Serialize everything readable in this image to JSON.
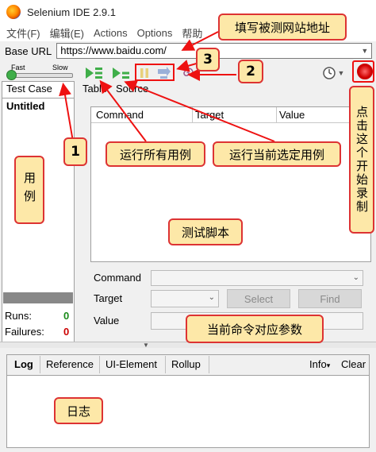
{
  "window": {
    "title": "Selenium IDE 2.9.1"
  },
  "menu": [
    "文件(F)",
    "编辑(E)",
    "Actions",
    "Options",
    "帮助"
  ],
  "base_url": {
    "label": "Base URL",
    "value": "https://www.baidu.com/"
  },
  "speed": {
    "fast_label": "Fast",
    "slow_label": "Slow"
  },
  "test_case_panel": {
    "header": "Test Case",
    "item": "Untitled",
    "runs_label": "Runs:",
    "runs_value": "0",
    "failures_label": "Failures:",
    "failures_value": "0"
  },
  "editor_tabs": {
    "table": "Table",
    "source": "Source"
  },
  "grid": {
    "columns": [
      "Command",
      "Target",
      "Value"
    ]
  },
  "form": {
    "command_label": "Command",
    "target_label": "Target",
    "value_label": "Value",
    "select_button": "Select",
    "find_button": "Find"
  },
  "log_tabs": {
    "log": "Log",
    "reference": "Reference",
    "ui_element": "UI-Element",
    "rollup": "Rollup",
    "info": "Info",
    "clear": "Clear"
  },
  "annotations": {
    "fill_url": "填写被测网站地址",
    "num1": "1",
    "num2": "2",
    "num3": "3",
    "run_all": "运行所有用例",
    "run_current": "运行当前选定用例",
    "start_record": "点击这个开始录制",
    "cases": "用例",
    "test_script": "测试脚本",
    "command_params": "当前命令对应参数",
    "log": "日志"
  },
  "colors": {
    "accent_red": "#dd2222",
    "callout_bg": "#fde8a8",
    "play_green": "#3fae49",
    "record_red": "#d00000"
  }
}
